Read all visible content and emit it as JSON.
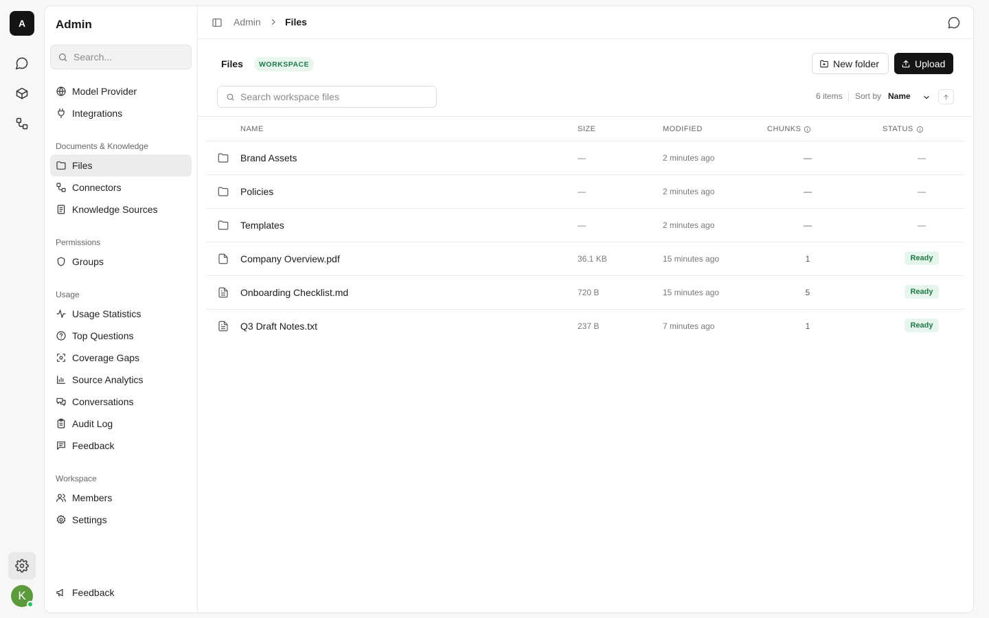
{
  "rail": {
    "logo_letter": "A",
    "avatar_letter": "K"
  },
  "sidebar": {
    "title": "Admin",
    "search_placeholder": "Search...",
    "items_top": [
      {
        "label": "Model Provider",
        "icon": "globe-icon"
      },
      {
        "label": "Integrations",
        "icon": "plug-icon"
      }
    ],
    "sections": {
      "docs": "Documents & Knowledge",
      "permissions": "Permissions",
      "usage": "Usage",
      "workspace": "Workspace"
    },
    "docs_items": [
      {
        "label": "Files",
        "icon": "folder-icon",
        "active": true
      },
      {
        "label": "Connectors",
        "icon": "connectors-icon"
      },
      {
        "label": "Knowledge Sources",
        "icon": "book-icon"
      }
    ],
    "permissions_items": [
      {
        "label": "Groups",
        "icon": "shield-icon"
      }
    ],
    "usage_items": [
      {
        "label": "Usage Statistics",
        "icon": "activity-icon"
      },
      {
        "label": "Top Questions",
        "icon": "help-circle-icon"
      },
      {
        "label": "Coverage Gaps",
        "icon": "scan-icon"
      },
      {
        "label": "Source Analytics",
        "icon": "bar-chart-icon"
      },
      {
        "label": "Conversations",
        "icon": "messages-icon"
      },
      {
        "label": "Audit Log",
        "icon": "clipboard-icon"
      },
      {
        "label": "Feedback",
        "icon": "message-square-text-icon"
      }
    ],
    "workspace_items": [
      {
        "label": "Members",
        "icon": "users-icon"
      },
      {
        "label": "Settings",
        "icon": "gear-icon"
      }
    ],
    "footer_feedback": "Feedback"
  },
  "breadcrumb": {
    "parent": "Admin",
    "current": "Files"
  },
  "page": {
    "title": "Files",
    "badge": "WORKSPACE",
    "new_folder_label": "New folder",
    "upload_label": "Upload",
    "search_placeholder": "Search workspace files",
    "item_count": "6 items",
    "sort_label": "Sort by",
    "sort_value": "Name"
  },
  "table": {
    "columns": {
      "name": "NAME",
      "size": "SIZE",
      "modified": "MODIFIED",
      "chunks": "CHUNKS",
      "status": "STATUS"
    },
    "rows": [
      {
        "name": "Brand Assets",
        "type": "folder",
        "size": "—",
        "modified": "2 minutes ago",
        "chunks": "—",
        "status": "—"
      },
      {
        "name": "Policies",
        "type": "folder",
        "size": "—",
        "modified": "2 minutes ago",
        "chunks": "—",
        "status": "—"
      },
      {
        "name": "Templates",
        "type": "folder",
        "size": "—",
        "modified": "2 minutes ago",
        "chunks": "—",
        "status": "—"
      },
      {
        "name": "Company Overview.pdf",
        "type": "file",
        "size": "36.1 KB",
        "modified": "15 minutes ago",
        "chunks": "1",
        "status": "Ready"
      },
      {
        "name": "Onboarding Checklist.md",
        "type": "text",
        "size": "720 B",
        "modified": "15 minutes ago",
        "chunks": "5",
        "status": "Ready"
      },
      {
        "name": "Q3 Draft Notes.txt",
        "type": "text",
        "size": "237 B",
        "modified": "7 minutes ago",
        "chunks": "1",
        "status": "Ready"
      }
    ]
  },
  "colors": {
    "accent_dark": "#141414",
    "ready_bg": "#e6f6ec",
    "ready_text": "#1f7a46",
    "avatar": "#5c9a3b",
    "online": "#22c55e"
  }
}
